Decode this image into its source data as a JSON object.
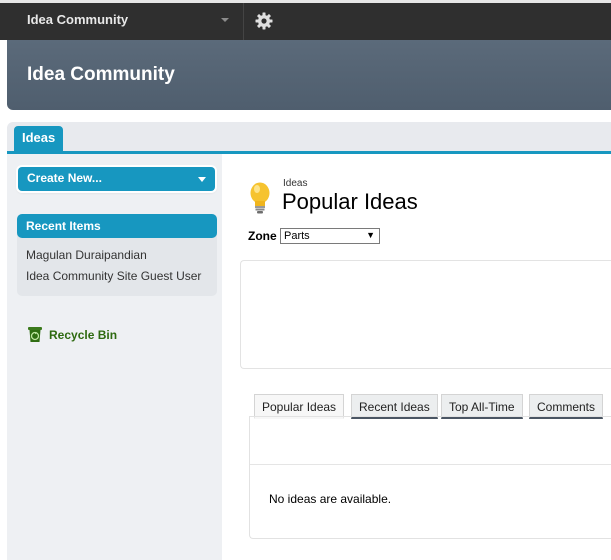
{
  "topbar": {
    "app_name": "Idea Community",
    "settings_icon": "gear-icon"
  },
  "header": {
    "title": "Idea Community"
  },
  "tabs": [
    {
      "label": "Ideas",
      "active": true
    }
  ],
  "sidebar": {
    "create_new_label": "Create New...",
    "recent_items_title": "Recent Items",
    "recent_items": [
      {
        "label": "Magulan Duraipandian"
      },
      {
        "label": "Idea Community Site Guest User"
      }
    ],
    "recycle_bin_label": "Recycle Bin",
    "recycle_bin_icon": "recycle-bin-icon"
  },
  "main": {
    "kicker": "Ideas",
    "title": "Popular Ideas",
    "title_icon": "lightbulb-icon",
    "zone_label": "Zone",
    "zone_value": "Parts",
    "idea_tabs": [
      {
        "label": "Popular Ideas",
        "active": true
      },
      {
        "label": "Recent Ideas",
        "active": false
      },
      {
        "label": "Top All-Time",
        "active": false
      },
      {
        "label": "Comments",
        "active": false
      }
    ],
    "empty_message": "No ideas are available."
  },
  "colors": {
    "accent": "#1797c0",
    "topbar": "#2f2f2f",
    "banner": "#566575",
    "recycle_text": "#2e6a10"
  }
}
